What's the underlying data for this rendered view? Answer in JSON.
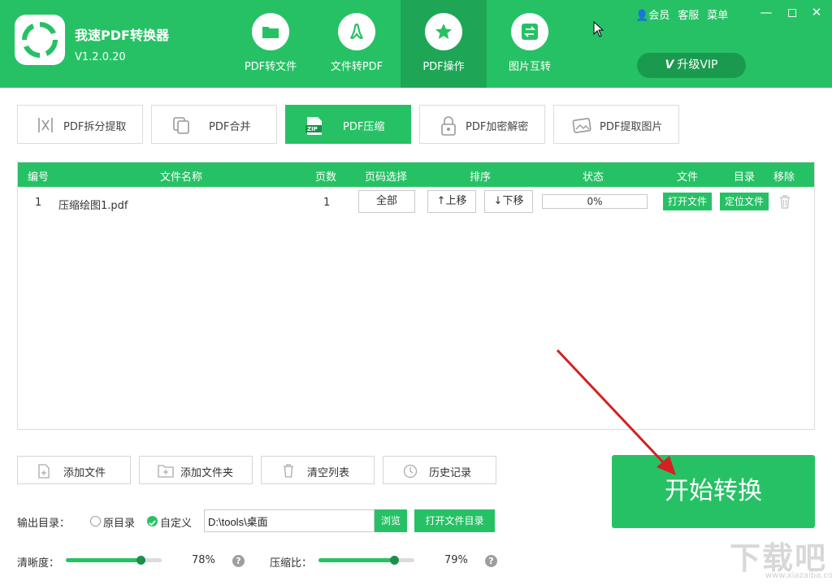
{
  "app": {
    "title": "我速PDF转换器",
    "version": "V1.2.0.20"
  },
  "nav_tabs": [
    {
      "label": "PDF转文件",
      "icon": "folder-icon"
    },
    {
      "label": "文件转PDF",
      "icon": "acrobat-icon"
    },
    {
      "label": "PDF操作",
      "icon": "star-icon"
    },
    {
      "label": "图片互转",
      "icon": "swap-icon"
    }
  ],
  "active_tab": "PDF操作",
  "top_links": {
    "member": "会员",
    "service": "客服",
    "menu": "菜单"
  },
  "vip": {
    "badge": "V",
    "label": "升级VIP"
  },
  "sub_tools": [
    {
      "label": "PDF拆分提取",
      "icon": "split-icon"
    },
    {
      "label": "PDF合并",
      "icon": "merge-icon"
    },
    {
      "label": "PDF压缩",
      "icon": "zip-icon",
      "icon_text": "ZIP"
    },
    {
      "label": "PDF加密解密",
      "icon": "lock-icon"
    },
    {
      "label": "PDF提取图片",
      "icon": "image-icon"
    }
  ],
  "table": {
    "headers": [
      "编号",
      "文件名称",
      "页数",
      "页码选择",
      "排序",
      "状态",
      "文件",
      "目录",
      "移除"
    ],
    "rows": [
      {
        "index": "1",
        "filename": "压缩绘图1.pdf",
        "pages": "1",
        "page_select": "全部",
        "move_up": "↑上移",
        "move_down": "↓下移",
        "progress_text": "0%",
        "progress": 0,
        "open_file": "打开文件",
        "locate_file": "定位文件"
      }
    ]
  },
  "actions": {
    "add_file": "添加文件",
    "add_folder": "添加文件夹",
    "clear_list": "清空列表",
    "history": "历史记录"
  },
  "start_button": "开始转换",
  "output": {
    "label": "输出目录：",
    "option_original": "原目录",
    "option_custom": "自定义",
    "selected": "自定义",
    "path": "D:\\tools\\桌面",
    "browse": "浏览",
    "open_folder": "打开文件目录"
  },
  "sliders": {
    "clarity": {
      "label": "清晰度：",
      "value": 78,
      "text": "78%"
    },
    "compression": {
      "label": "压缩比：",
      "value": 79,
      "text": "79%"
    }
  },
  "watermark": {
    "big": "下载吧",
    "small": "www.xiazaiba.com"
  },
  "colors": {
    "brand": "#27c165",
    "brand_dark": "#1ea656"
  }
}
